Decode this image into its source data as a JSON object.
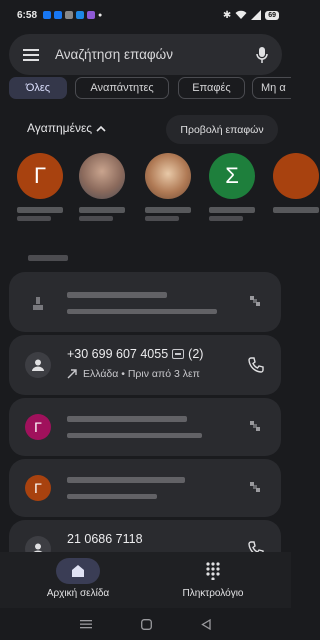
{
  "status_bar": {
    "time": "6:58",
    "battery": "69"
  },
  "search": {
    "placeholder": "Αναζήτηση επαφών"
  },
  "filter_chips": [
    {
      "label": "Όλες",
      "active": true
    },
    {
      "label": "Αναπάντητες",
      "active": false
    },
    {
      "label": "Επαφές",
      "active": false
    },
    {
      "label": "Μη α",
      "active": false
    }
  ],
  "favorites": {
    "header": "Αγαπημένες",
    "view_contacts": "Προβολή επαφών",
    "items": [
      {
        "initial": "Γ",
        "color": "#a8420f"
      },
      {
        "initial": "",
        "color": "#8b7d78"
      },
      {
        "initial": "",
        "color": "#b08464"
      },
      {
        "initial": "Σ",
        "color": "#1e7f3c"
      },
      {
        "initial": "",
        "color": "#a8420f"
      }
    ]
  },
  "recents": [
    {
      "initial": "",
      "icon_color": "#3d3e43"
    },
    {
      "number": "+30 699 607 4055",
      "count": "(2)",
      "sub": "Ελλάδα • Πριν από 3 λεπ",
      "icon_color": "#3d3e43"
    },
    {
      "initial": "Γ",
      "icon_color": "#a0115c"
    },
    {
      "initial": "Γ",
      "icon_color": "#a8420f"
    },
    {
      "number": "21 0686 7118",
      "icon_color": "#3d3e43"
    }
  ],
  "bottom_nav": {
    "home": "Αρχική σελίδα",
    "keypad": "Πληκτρολόγιο"
  }
}
